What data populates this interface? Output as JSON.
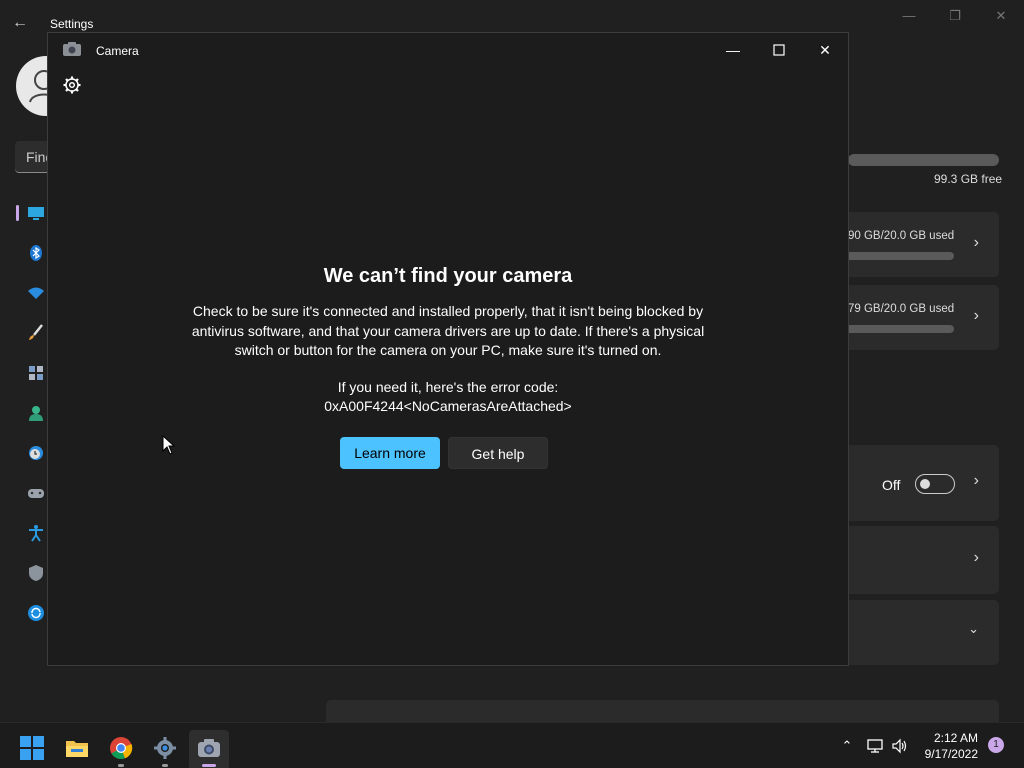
{
  "settings": {
    "title": "Settings",
    "search_placeholder": "Find",
    "storage_free": "99.3 GB free",
    "cards": [
      {
        "usage": "90 GB/20.0 GB used"
      },
      {
        "usage": "79 GB/20.0 GB used"
      }
    ],
    "toggle_state": "Off"
  },
  "camera_window": {
    "title": "Camera",
    "error": {
      "heading": "We can’t find your camera",
      "body": "Check to be sure it's connected and installed properly, that it isn't being blocked by antivirus software, and that your camera drivers are up to date. If there's a physical switch or button for the camera on your PC, make sure it's turned on.",
      "code_label": "If you need it, here's the error code:",
      "code": "0xA00F4244<NoCamerasAreAttached>"
    },
    "buttons": {
      "learn_more": "Learn more",
      "get_help": "Get help"
    }
  },
  "taskbar": {
    "time": "2:12 AM",
    "date": "9/17/2022",
    "notification_count": "1"
  },
  "colors": {
    "accent": "#4cc2ff",
    "window_bg": "#1c1c1c",
    "taskbar_bg": "#1c1c1c",
    "indicator": "#c9a7e8"
  }
}
